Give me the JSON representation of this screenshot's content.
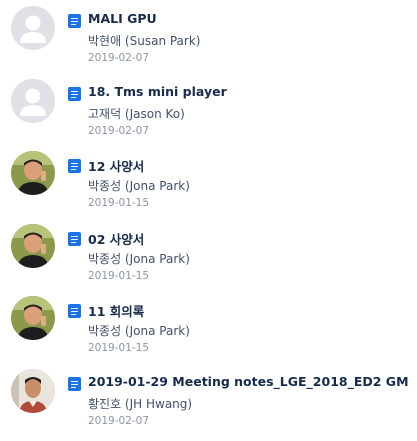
{
  "items": [
    {
      "title": "MALI GPU",
      "author": "박현애 (Susan Park)",
      "date": "2019-02-07",
      "avatar": "default-avatar-icon",
      "doc_icon": "document-icon"
    },
    {
      "title": "18. Tms mini player",
      "author": "고재덕 (Jason Ko)",
      "date": "2019-02-07",
      "avatar": "default-avatar-icon",
      "doc_icon": "document-icon"
    },
    {
      "title": "12 사양서",
      "author": "박종성 (Jona Park)",
      "date": "2019-01-15",
      "avatar": "user-photo",
      "doc_icon": "document-icon"
    },
    {
      "title": "02 사양서",
      "author": "박종성 (Jona Park)",
      "date": "2019-01-15",
      "avatar": "user-photo",
      "doc_icon": "document-icon"
    },
    {
      "title": "11 회의록",
      "author": "박종성 (Jona Park)",
      "date": "2019-01-15",
      "avatar": "user-photo",
      "doc_icon": "document-icon"
    },
    {
      "title": "2019-01-29 Meeting notes_LGE_2018_ED2 GM",
      "author": "황진호 (JH Hwang)",
      "date": "2019-02-07",
      "avatar": "user-photo",
      "doc_icon": "document-icon"
    }
  ],
  "colors": {
    "doc_icon": "#1a73e8",
    "title": "#172b4d",
    "author": "#42526e",
    "date": "#8c95a5"
  }
}
